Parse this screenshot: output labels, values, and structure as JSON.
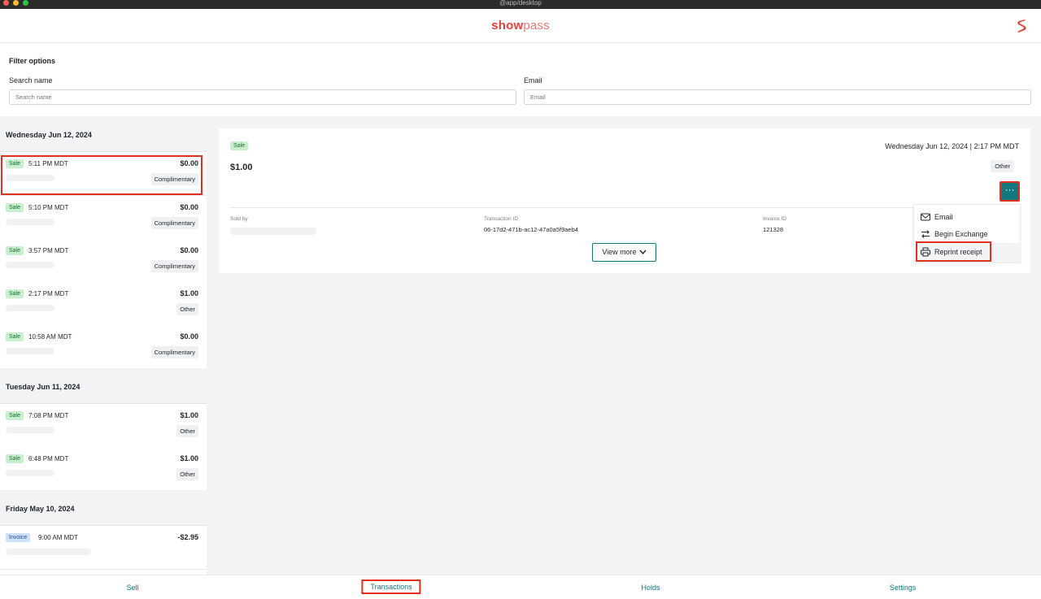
{
  "window": {
    "title": "@app/desktop",
    "controls": {
      "close_color": "#ff5f57",
      "minimize_color": "#febc2e",
      "zoom_color": "#28c840"
    }
  },
  "header": {
    "logo_part1": "show",
    "logo_part2": "pass",
    "brand_icon": "showpass-s-icon"
  },
  "filter": {
    "title": "Filter options",
    "name_label": "Search name",
    "name_placeholder": "Search name",
    "email_label": "Email",
    "email_placeholder": "Email"
  },
  "transactions": [
    {
      "date": "Wednesday Jun 12, 2024",
      "items": [
        {
          "type": "Sale",
          "time": "5:11 PM MDT",
          "amount": "$0.00",
          "tag": "Complimentary"
        },
        {
          "type": "Sale",
          "time": "5:10 PM MDT",
          "amount": "$0.00",
          "tag": "Complimentary"
        },
        {
          "type": "Sale",
          "time": "3:57 PM MDT",
          "amount": "$0.00",
          "tag": "Complimentary"
        },
        {
          "type": "Sale",
          "time": "2:17 PM MDT",
          "amount": "$1.00",
          "tag": "Other"
        },
        {
          "type": "Sale",
          "time": "10:58 AM MDT",
          "amount": "$0.00",
          "tag": "Complimentary"
        }
      ]
    },
    {
      "date": "Tuesday Jun 11, 2024",
      "items": [
        {
          "type": "Sale",
          "time": "7:08 PM MDT",
          "amount": "$1.00",
          "tag": "Other"
        },
        {
          "type": "Sale",
          "time": "6:48 PM MDT",
          "amount": "$1.00",
          "tag": "Other"
        }
      ]
    },
    {
      "date": "Friday May 10, 2024",
      "items": [
        {
          "type": "Invoice",
          "time": "9:00 AM MDT",
          "amount": "-$2.95",
          "tag": ""
        }
      ]
    }
  ],
  "detail": {
    "type": "Sale",
    "datetime": "Wednesday Jun 12, 2024 | 2:17 PM MDT",
    "amount": "$1.00",
    "tag": "Other",
    "more_label": "···",
    "sold_by_label": "Sold by",
    "transaction_id_label": "Transaction ID",
    "transaction_id": "06-17d2-471b-ac12-47a0a5f9aeb4",
    "invoice_id_label": "Invoice ID",
    "invoice_id": "121328",
    "view_more": "View more"
  },
  "menu": {
    "items": [
      {
        "label": "Email",
        "icon": "envelope-icon"
      },
      {
        "label": "Begin Exchange",
        "icon": "exchange-arrows-icon"
      },
      {
        "label": "Reprint receipt",
        "icon": "printer-icon"
      }
    ]
  },
  "nav": {
    "items": [
      "Sell",
      "Transactions",
      "Holds",
      "Settings"
    ],
    "active": "Transactions"
  },
  "colors": {
    "accent": "#12787e",
    "brand": "#e0413a",
    "highlight_box": "#e0301e",
    "sale_badge_bg": "#c8f0cf",
    "invoice_badge_bg": "#cfe0fa"
  }
}
